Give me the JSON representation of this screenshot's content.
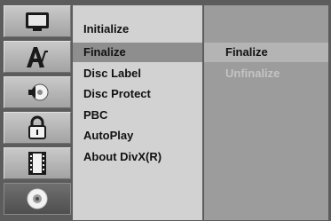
{
  "sidebar": {
    "icons": [
      {
        "name": "tv-icon"
      },
      {
        "name": "language-icon"
      },
      {
        "name": "audio-icon"
      },
      {
        "name": "lock-icon"
      },
      {
        "name": "film-icon"
      },
      {
        "name": "disc-icon",
        "active": true
      }
    ]
  },
  "menu": {
    "items": [
      {
        "label": "Initialize"
      },
      {
        "label": "Finalize",
        "selected": true
      },
      {
        "label": "Disc Label"
      },
      {
        "label": "Disc Protect"
      },
      {
        "label": "PBC"
      },
      {
        "label": "AutoPlay"
      },
      {
        "label": "About DivX(R)"
      }
    ]
  },
  "submenu": {
    "items": [
      {
        "label": "Finalize",
        "selected": true
      },
      {
        "label": "Unfinalize",
        "disabled": true
      }
    ]
  },
  "colors": {
    "background": "#5c5c5c",
    "menu_bg": "#d2d2d2",
    "menu_highlight": "#8e8e8e",
    "submenu_bg": "#9c9c9c",
    "submenu_highlight": "#b4b4b4",
    "disabled_text": "#c4c4c4"
  }
}
